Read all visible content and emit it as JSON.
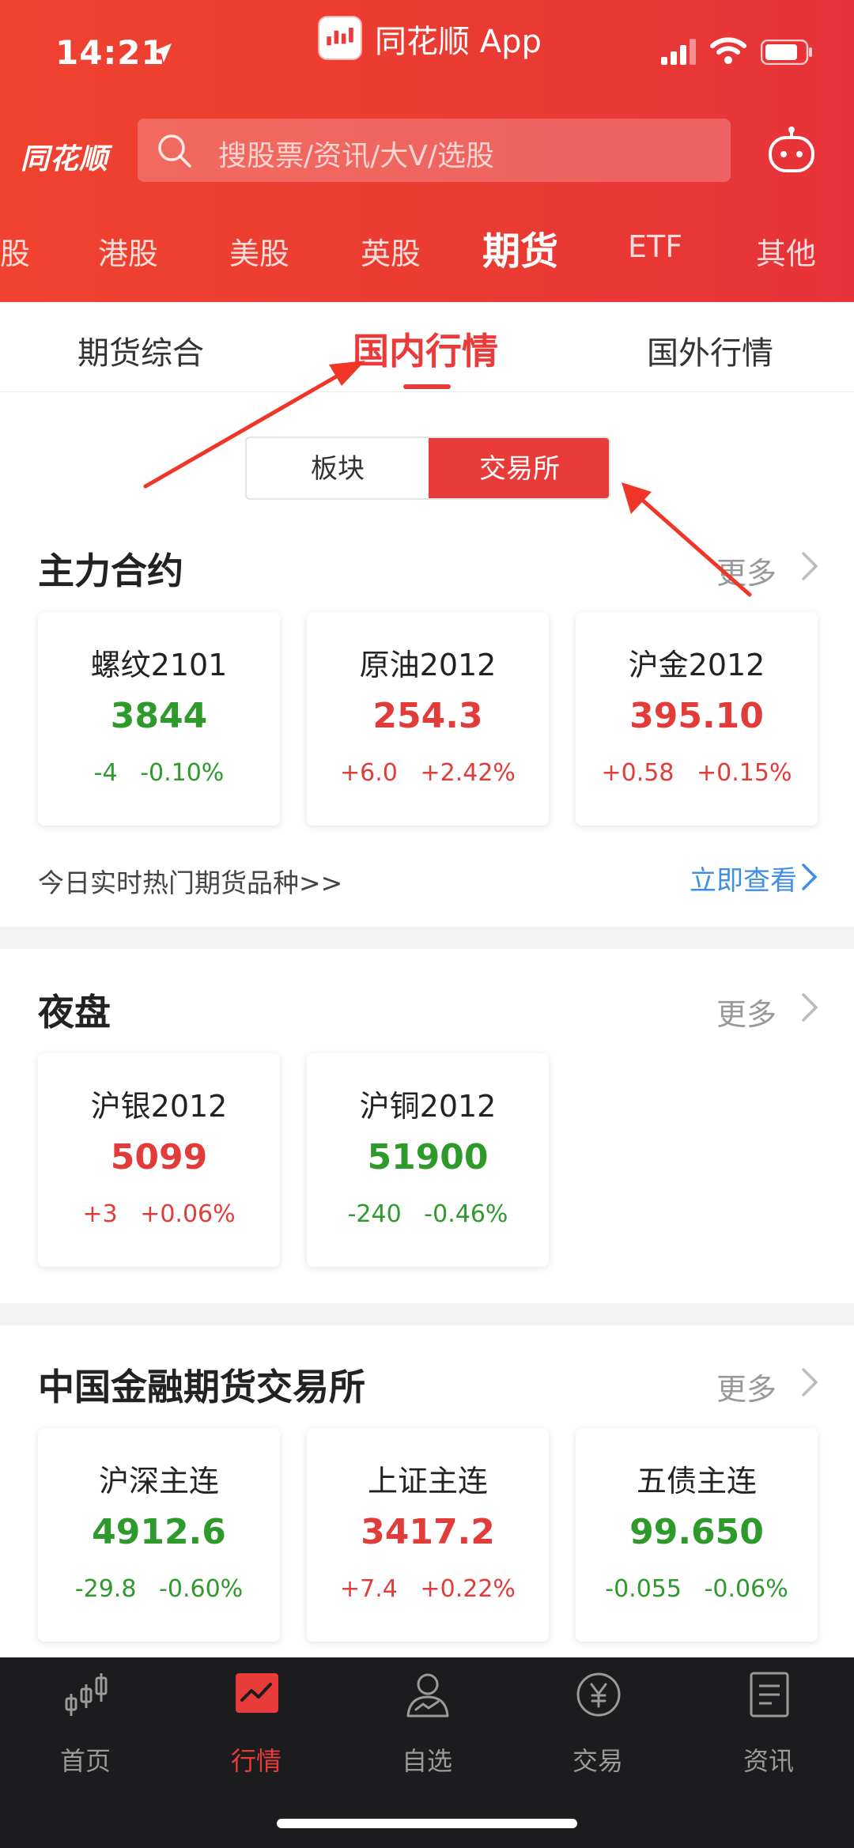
{
  "status_bar": {
    "time": "14:21",
    "app_name": "同花顺 App"
  },
  "header": {
    "logo": "同花顺",
    "search_placeholder": "搜股票/资讯/大V/选股"
  },
  "market_tabs": [
    "股",
    "港股",
    "美股",
    "英股",
    "期货",
    "ETF",
    "其他"
  ],
  "active_market_tab": "期货",
  "sub_tabs": [
    "期货综合",
    "国内行情",
    "国外行情"
  ],
  "active_sub_tab": "国内行情",
  "segment": {
    "options": [
      "板块",
      "交易所"
    ],
    "active": "交易所"
  },
  "sections": {
    "main_contracts": {
      "title": "主力合约",
      "more": "更多",
      "cards": [
        {
          "name": "螺纹2101",
          "price": "3844",
          "change": "-4",
          "percent": "-0.10%",
          "trend": "down"
        },
        {
          "name": "原油2012",
          "price": "254.3",
          "change": "+6.0",
          "percent": "+2.42%",
          "trend": "up"
        },
        {
          "name": "沪金2012",
          "price": "395.10",
          "change": "+0.58",
          "percent": "+0.15%",
          "trend": "up"
        }
      ],
      "hot_text": "今日实时热门期货品种>>",
      "hot_link": "立即查看"
    },
    "night": {
      "title": "夜盘",
      "more": "更多",
      "cards": [
        {
          "name": "沪银2012",
          "price": "5099",
          "change": "+3",
          "percent": "+0.06%",
          "trend": "up"
        },
        {
          "name": "沪铜2012",
          "price": "51900",
          "change": "-240",
          "percent": "-0.46%",
          "trend": "down"
        }
      ]
    },
    "cffex": {
      "title": "中国金融期货交易所",
      "more": "更多",
      "cards": [
        {
          "name": "沪深主连",
          "price": "4912.6",
          "change": "-29.8",
          "percent": "-0.60%",
          "trend": "down"
        },
        {
          "name": "上证主连",
          "price": "3417.2",
          "change": "+7.4",
          "percent": "+0.22%",
          "trend": "up"
        },
        {
          "name": "五债主连",
          "price": "99.650",
          "change": "-0.055",
          "percent": "-0.06%",
          "trend": "down"
        }
      ]
    }
  },
  "bottom_nav": [
    {
      "label": "首页",
      "icon": "candlestick-icon"
    },
    {
      "label": "行情",
      "icon": "market-chart-icon"
    },
    {
      "label": "自选",
      "icon": "user-chart-icon"
    },
    {
      "label": "交易",
      "icon": "yuan-coin-icon"
    },
    {
      "label": "资讯",
      "icon": "news-doc-icon"
    }
  ],
  "active_nav": "行情",
  "colors": {
    "brand_red": "#e93b3a",
    "up": "#e23c3a",
    "down": "#2f9a2c",
    "link": "#3f8ee6"
  }
}
